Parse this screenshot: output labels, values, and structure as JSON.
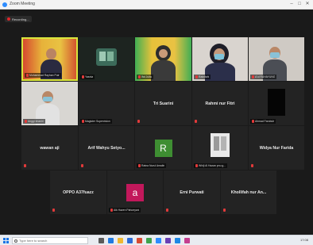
{
  "window": {
    "title": "Zoom Meeting"
  },
  "recording": {
    "label": "Recording..."
  },
  "participants": [
    {
      "name": "Muhammad Rayhan Putr",
      "type": "video"
    },
    {
      "name": "Yasnia",
      "type": "video"
    },
    {
      "name": "Ifat Juita",
      "type": "video"
    },
    {
      "name": "Ratnitahi",
      "type": "video"
    },
    {
      "name": "A'ul RAHAYUNG",
      "type": "video"
    },
    {
      "name": "Anggi Imaniri",
      "type": "video"
    },
    {
      "name": "Magister Supervision",
      "type": "blank"
    },
    {
      "name": "Tri Suarini",
      "type": "name"
    },
    {
      "name": "Rahmi nur Fitri",
      "type": "name"
    },
    {
      "name": "Ahmad Farobuh",
      "type": "video-dark"
    },
    {
      "name": "wawan aji",
      "type": "name"
    },
    {
      "name": "Arif Wahyu Setyo...",
      "type": "name"
    },
    {
      "name": "Ratna Nurul Amalin",
      "type": "avatar",
      "letter": "R"
    },
    {
      "name": "Whiji Al Hazan pnu g...",
      "type": "video"
    },
    {
      "name": "Widya Nur Farida",
      "type": "name"
    },
    {
      "name": "OPPO A37fuazz",
      "type": "name"
    },
    {
      "name": "Aik Hazen Pahoeyani",
      "type": "avatar",
      "letter": "a"
    },
    {
      "name": "Erni Purwati",
      "type": "name"
    },
    {
      "name": "Khollifah nur An...",
      "type": "name"
    }
  ],
  "colors": {
    "active_speaker": "#d9e63c",
    "avatar_r": "#3e8e32",
    "avatar_a": "#c2185b",
    "mic_off": "#e23a3a"
  },
  "taskbar": {
    "search_placeholder": "Type here to search",
    "time": "17:08"
  }
}
